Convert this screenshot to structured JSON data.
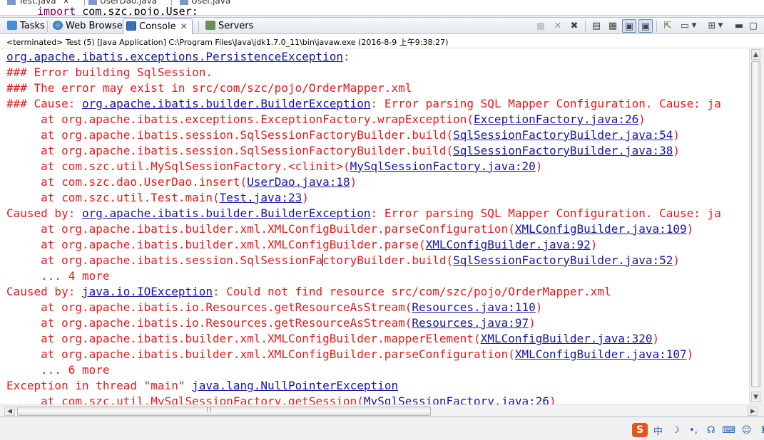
{
  "editor_tabs": [
    {
      "label": "Test.java",
      "close": "✕"
    },
    {
      "label": "UserDao.java"
    },
    {
      "label": "User.java"
    }
  ],
  "editor_peek": {
    "keyword": "import",
    "rest": " com.szc.pojo.User;"
  },
  "view_tabs": [
    {
      "label": "Tasks",
      "active": false
    },
    {
      "label": "Web Browser",
      "active": false
    },
    {
      "label": "Console",
      "active": true,
      "close": "✕"
    },
    {
      "label": "Servers",
      "active": false
    }
  ],
  "launch_info": "<terminated> Test (5) [Java Application] C:\\Program Files\\Java\\jdk1.7.0_11\\bin\\javaw.exe (2016-8-9 上午9:38:27)",
  "console_lines": [
    {
      "parts": [
        {
          "t": "org.apache.ibatis.exceptions.PersistenceException",
          "link": true
        },
        {
          "t": ":"
        }
      ]
    },
    {
      "parts": [
        {
          "t": "### Error building SqlSession."
        }
      ]
    },
    {
      "parts": [
        {
          "t": "### The error may exist in src/com/szc/pojo/OrderMapper.xml"
        }
      ]
    },
    {
      "parts": [
        {
          "t": "### Cause: "
        },
        {
          "t": "org.apache.ibatis.builder.BuilderException",
          "link": true
        },
        {
          "t": ": Error parsing SQL Mapper Configuration. Cause: ja"
        }
      ]
    },
    {
      "parts": [
        {
          "t": "\tat org.apache.ibatis.exceptions.ExceptionFactory.wrapException("
        },
        {
          "t": "ExceptionFactory.java:26",
          "link": true
        },
        {
          "t": ")"
        }
      ]
    },
    {
      "parts": [
        {
          "t": "\tat org.apache.ibatis.session.SqlSessionFactoryBuilder.build("
        },
        {
          "t": "SqlSessionFactoryBuilder.java:54",
          "link": true
        },
        {
          "t": ")"
        }
      ]
    },
    {
      "parts": [
        {
          "t": "\tat org.apache.ibatis.session.SqlSessionFactoryBuilder.build("
        },
        {
          "t": "SqlSessionFactoryBuilder.java:38",
          "link": true
        },
        {
          "t": ")"
        }
      ]
    },
    {
      "parts": [
        {
          "t": "\tat com.szc.util.MySqlSessionFactory.<clinit>("
        },
        {
          "t": "MySqlSessionFactory.java:20",
          "link": true
        },
        {
          "t": ")"
        }
      ]
    },
    {
      "parts": [
        {
          "t": "\tat com.szc.dao.UserDao.insert("
        },
        {
          "t": "UserDao.java:18",
          "link": true
        },
        {
          "t": ")"
        }
      ]
    },
    {
      "parts": [
        {
          "t": "\tat com.szc.util.Test.main("
        },
        {
          "t": "Test.java:23",
          "link": true
        },
        {
          "t": ")"
        }
      ]
    },
    {
      "parts": [
        {
          "t": "Caused by: "
        },
        {
          "t": "org.apache.ibatis.builder.BuilderException",
          "link": true
        },
        {
          "t": ": Error parsing SQL Mapper Configuration. Cause: ja"
        }
      ]
    },
    {
      "parts": [
        {
          "t": "\tat org.apache.ibatis.builder.xml.XMLConfigBuilder.parseConfiguration("
        },
        {
          "t": "XMLConfigBuilder.java:109",
          "link": true
        },
        {
          "t": ")"
        }
      ]
    },
    {
      "parts": [
        {
          "t": "\tat org.apache.ibatis.builder.xml.XMLConfigBuilder.parse("
        },
        {
          "t": "XMLConfigBuilder.java:92",
          "link": true
        },
        {
          "t": ")"
        }
      ]
    },
    {
      "parts": [
        {
          "t": "\tat org.apache.ibatis.session.SqlSessionFa"
        },
        {
          "t": "",
          "caret": true
        },
        {
          "t": "ctoryBuilder.build("
        },
        {
          "t": "SqlSessionFactoryBuilder.java:52",
          "link": true
        },
        {
          "t": ")"
        }
      ]
    },
    {
      "parts": [
        {
          "t": "\t... 4 more"
        }
      ]
    },
    {
      "parts": [
        {
          "t": "Caused by: "
        },
        {
          "t": "java.io.IOException",
          "link": true
        },
        {
          "t": ": Could not find resource src/com/szc/pojo/OrderMapper.xml"
        }
      ]
    },
    {
      "parts": [
        {
          "t": "\tat org.apache.ibatis.io.Resources.getResourceAsStream("
        },
        {
          "t": "Resources.java:110",
          "link": true
        },
        {
          "t": ")"
        }
      ]
    },
    {
      "parts": [
        {
          "t": "\tat org.apache.ibatis.io.Resources.getResourceAsStream("
        },
        {
          "t": "Resources.java:97",
          "link": true
        },
        {
          "t": ")"
        }
      ]
    },
    {
      "parts": [
        {
          "t": "\tat org.apache.ibatis.builder.xml.XMLConfigBuilder.mapperElement("
        },
        {
          "t": "XMLConfigBuilder.java:320",
          "link": true
        },
        {
          "t": ")"
        }
      ]
    },
    {
      "parts": [
        {
          "t": "\tat org.apache.ibatis.builder.xml.XMLConfigBuilder.parseConfiguration("
        },
        {
          "t": "XMLConfigBuilder.java:107",
          "link": true
        },
        {
          "t": ")"
        }
      ]
    },
    {
      "parts": [
        {
          "t": "\t... 6 more"
        }
      ]
    },
    {
      "parts": [
        {
          "t": "Exception in thread \"main\" "
        },
        {
          "t": "java.lang.NullPointerException",
          "link": true
        }
      ]
    },
    {
      "parts": [
        {
          "t": "\tat com.szc.util.MySqlSessionFactory.getSession("
        },
        {
          "t": "MySqlSessionFactory.java:26",
          "link": true
        },
        {
          "t": ")"
        }
      ]
    }
  ],
  "ime": {
    "logo": "S",
    "mode": "中"
  },
  "colors": {
    "error_text": "#e21b1b",
    "link": "#1616a0"
  }
}
